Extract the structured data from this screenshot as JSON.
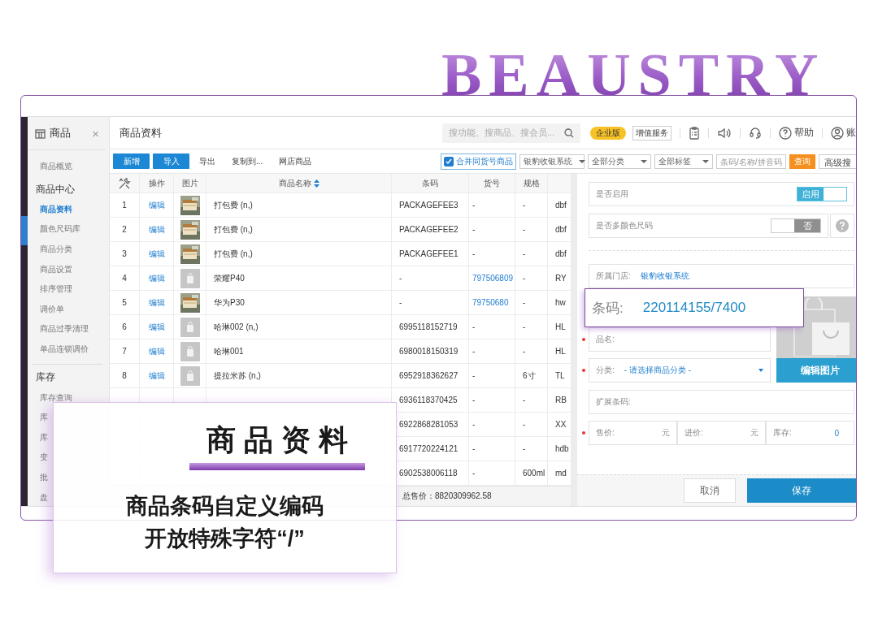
{
  "brand": {
    "title": "BEAUSTRY"
  },
  "sidebar": {
    "title": "商品",
    "close": "×",
    "items": [
      {
        "label": "商品概览",
        "kind": "item",
        "selected": false
      },
      {
        "label": "商品中心",
        "kind": "heading"
      },
      {
        "label": "商品资料",
        "kind": "item",
        "selected": true
      },
      {
        "label": "颜色尺码库",
        "kind": "item",
        "selected": false
      },
      {
        "label": "商品分类",
        "kind": "item",
        "selected": false
      },
      {
        "label": "商品设置",
        "kind": "item",
        "selected": false
      },
      {
        "label": "排序管理",
        "kind": "item",
        "selected": false
      },
      {
        "label": "调价单",
        "kind": "item",
        "selected": false
      },
      {
        "label": "商品过季清理",
        "kind": "item",
        "selected": false
      },
      {
        "label": "单品连锁调价",
        "kind": "item",
        "selected": false
      },
      {
        "label": "库存",
        "kind": "heading"
      },
      {
        "label": "库存查询",
        "kind": "item",
        "selected": false
      },
      {
        "label": "库",
        "kind": "item",
        "selected": false
      },
      {
        "label": "库",
        "kind": "item",
        "selected": false
      },
      {
        "label": "变",
        "kind": "item",
        "selected": false
      },
      {
        "label": "批",
        "kind": "item",
        "selected": false
      },
      {
        "label": "盘",
        "kind": "item",
        "selected": false
      }
    ]
  },
  "header": {
    "title": "商品资料",
    "search_placeholder": "搜功能、搜商品、搜会员...",
    "edition": "企业版",
    "value_added": "增值服务",
    "help": "帮助",
    "account": "账"
  },
  "toolbar": {
    "buttons": [
      {
        "label": "新增",
        "kind": "primary"
      },
      {
        "label": "导入",
        "kind": "primary"
      },
      {
        "label": "导出",
        "kind": "link"
      },
      {
        "label": "复制到...",
        "kind": "link"
      },
      {
        "label": "网店商品",
        "kind": "link"
      }
    ],
    "merge": {
      "label": "合并同货号商品",
      "checked": true
    },
    "filters": [
      {
        "label": "银豹收银系统"
      },
      {
        "label": "全部分类"
      },
      {
        "label": "全部标签"
      }
    ],
    "search_placeholder": "条码/名称/拼音码",
    "query": "查询",
    "advanced": "高级搜"
  },
  "table": {
    "columns": [
      {
        "label": "操作",
        "sortable": false
      },
      {
        "label": "图片",
        "sortable": false
      },
      {
        "label": "商品名称",
        "sortable": true
      },
      {
        "label": "条码",
        "sortable": false
      },
      {
        "label": "货号",
        "sortable": false
      },
      {
        "label": "规格",
        "sortable": false
      }
    ],
    "rows": [
      {
        "no": "1",
        "action": "编辑",
        "name": "打包费 (n,)",
        "barcode": "PACKAGEFEE3",
        "item_no": "-",
        "item_no_link": false,
        "spec": "-",
        "column_8": "dbf"
      },
      {
        "no": "2",
        "action": "编辑",
        "name": "打包费 (n,)",
        "barcode": "PACKAGEFEE2",
        "item_no": "-",
        "item_no_link": false,
        "spec": "-",
        "column_8": "dbf"
      },
      {
        "no": "3",
        "action": "编辑",
        "name": "打包费 (n,)",
        "barcode": "PACKAGEFEE1",
        "item_no": "-",
        "item_no_link": false,
        "spec": "-",
        "column_8": "dbf"
      },
      {
        "no": "4",
        "action": "编辑",
        "kind": "placeholder",
        "name": "荣耀P40",
        "barcode": "-",
        "item_no": "797506809",
        "item_no_link": true,
        "spec": "-",
        "column_8": "RY"
      },
      {
        "no": "5",
        "action": "编辑",
        "name": "华为P30",
        "barcode": "-",
        "item_no": "79750680",
        "item_no_link": true,
        "spec": "-",
        "column_8": "hw"
      },
      {
        "no": "6",
        "action": "编辑",
        "kind": "placeholder",
        "name": "哈琳002 (n,)",
        "barcode": "6995118152719",
        "item_no": "-",
        "item_no_link": false,
        "spec": "-",
        "column_8": "HL"
      },
      {
        "no": "7",
        "action": "编辑",
        "kind": "placeholder",
        "name": "哈琳001",
        "barcode": "6980018150319",
        "item_no": "-",
        "item_no_link": false,
        "spec": "-",
        "column_8": "HL"
      },
      {
        "no": "8",
        "action": "编辑",
        "kind": "placeholder",
        "name": "提拉米苏 (n,)",
        "barcode": "6952918362627",
        "item_no": "-",
        "item_no_link": false,
        "spec": "6寸",
        "column_8": "TL"
      },
      {
        "barcode": "6936118370425",
        "item_no": "-",
        "item_no_link": false,
        "spec": "-",
        "column_8": "RB"
      },
      {
        "barcode": "6922868281053",
        "item_no": "-",
        "item_no_link": false,
        "spec": "-",
        "column_8": "XX"
      },
      {
        "barcode": "6917720224121",
        "item_no": "-",
        "item_no_link": false,
        "spec": "-",
        "column_8": "hdb"
      },
      {
        "barcode": "6902538006118",
        "item_no": "-",
        "item_no_link": false,
        "spec": "600ml",
        "column_8": "md"
      }
    ],
    "footer": "总售价：8820309962.58"
  },
  "panel": {
    "toggles": [
      {
        "label": "是否启用",
        "on": true,
        "text": "启用",
        "help": false
      },
      {
        "label": "是否多颜色尺码",
        "on": false,
        "text": "否",
        "help": true
      }
    ],
    "store": {
      "label": "所属门店:",
      "value": "银豹收银系统"
    },
    "barcode": {
      "label": "条码:",
      "value": "220114155/7400"
    },
    "name_field": {
      "label": "品名:",
      "required": true
    },
    "category": {
      "label": "分类:",
      "value": "- 请选择商品分类 -",
      "required": true
    },
    "edit_image": "编辑图片",
    "ext_barcode": {
      "label": "扩展条码:"
    },
    "prices_required": true,
    "prices": [
      {
        "label": "售价:",
        "unit": "元"
      },
      {
        "label": "进价:",
        "unit": "元"
      },
      {
        "label": "库存:",
        "value": "0"
      }
    ],
    "cancel": "取消",
    "save": "保存"
  },
  "promo": {
    "title": "商品资料",
    "lines": [
      "商品条码自定义编码",
      "开放特殊字符“/”"
    ]
  }
}
